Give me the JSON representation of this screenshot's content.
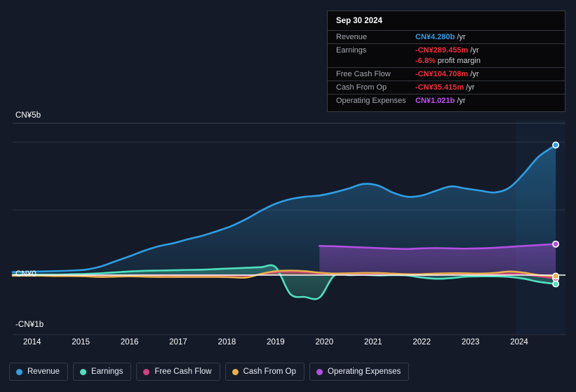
{
  "tooltip": {
    "date": "Sep 30 2024",
    "rows": [
      {
        "label": "Revenue",
        "value": "CN¥4.280b",
        "unit": "/yr",
        "color": "c-blue"
      },
      {
        "label": "Earnings",
        "value": "-CN¥289.455m",
        "unit": "/yr",
        "color": "c-red"
      },
      {
        "label": "",
        "value": "-6.8%",
        "unit": "profit margin",
        "color": "c-red",
        "sub": true
      },
      {
        "label": "Free Cash Flow",
        "value": "-CN¥104.708m",
        "unit": "/yr",
        "color": "c-red"
      },
      {
        "label": "Cash From Op",
        "value": "-CN¥35.415m",
        "unit": "/yr",
        "color": "c-red"
      },
      {
        "label": "Operating Expenses",
        "value": "CN¥1.021b",
        "unit": "/yr",
        "color": "c-purple"
      }
    ]
  },
  "axis": {
    "y_top": "CN¥5b",
    "y_zero": "CN¥0",
    "y_bottom": "-CN¥1b"
  },
  "legend": {
    "items": [
      {
        "label": "Revenue",
        "color": "#2f9fe3"
      },
      {
        "label": "Earnings",
        "color": "#4fe0c0"
      },
      {
        "label": "Free Cash Flow",
        "color": "#d2427f"
      },
      {
        "label": "Cash From Op",
        "color": "#e8b04b"
      },
      {
        "label": "Operating Expenses",
        "color": "#b24fe0"
      }
    ]
  },
  "chart_data": {
    "type": "area",
    "title": "",
    "xlabel": "",
    "ylabel": "CN¥",
    "xlim": [
      2013.6,
      2024.95
    ],
    "ylim": [
      -1.35,
      5.6
    ],
    "grid": true,
    "legend_position": "bottom",
    "currency": "CN¥",
    "units": "billions",
    "tick_labels_x": [
      "2014",
      "2015",
      "2016",
      "2017",
      "2018",
      "2019",
      "2020",
      "2021",
      "2022",
      "2023",
      "2024"
    ],
    "tick_labels_y": [
      "CN¥5b",
      "CN¥0",
      "-CN¥1b"
    ],
    "highlight_band": {
      "from": 2024.25,
      "to": 2024.95
    },
    "x": [
      2013.6,
      2013.9,
      2014.2,
      2014.5,
      2014.8,
      2015.1,
      2015.4,
      2015.7,
      2016.0,
      2016.3,
      2016.6,
      2016.9,
      2017.2,
      2017.5,
      2017.8,
      2018.1,
      2018.4,
      2018.7,
      2019.0,
      2019.3,
      2019.6,
      2019.9,
      2020.2,
      2020.5,
      2020.8,
      2021.1,
      2021.4,
      2021.7,
      2022.0,
      2022.3,
      2022.6,
      2022.9,
      2023.2,
      2023.5,
      2023.8,
      2024.1,
      2024.4,
      2024.75
    ],
    "series": [
      {
        "name": "Revenue",
        "color": "#2f9fe3",
        "values": [
          0.1,
          0.11,
          0.12,
          0.13,
          0.15,
          0.18,
          0.28,
          0.45,
          0.62,
          0.8,
          0.95,
          1.05,
          1.18,
          1.3,
          1.45,
          1.62,
          1.85,
          2.12,
          2.35,
          2.5,
          2.58,
          2.62,
          2.72,
          2.85,
          3.0,
          2.95,
          2.72,
          2.58,
          2.62,
          2.78,
          2.92,
          2.85,
          2.78,
          2.72,
          2.88,
          3.35,
          3.9,
          4.28
        ]
      },
      {
        "name": "Earnings",
        "color": "#4fe0c0",
        "values": [
          0.02,
          0.02,
          0.02,
          0.02,
          0.03,
          0.04,
          0.06,
          0.09,
          0.12,
          0.14,
          0.15,
          0.16,
          0.17,
          0.18,
          0.2,
          0.22,
          0.24,
          0.26,
          0.26,
          -0.62,
          -0.72,
          -0.74,
          -0.02,
          0.0,
          0.01,
          -0.01,
          0.0,
          -0.01,
          -0.08,
          -0.12,
          -0.1,
          -0.05,
          -0.04,
          -0.04,
          -0.06,
          -0.12,
          -0.22,
          -0.289
        ]
      },
      {
        "name": "Free Cash Flow",
        "color": "#d2427f",
        "values": [
          -0.01,
          -0.01,
          -0.01,
          -0.01,
          -0.01,
          -0.01,
          -0.01,
          -0.01,
          -0.01,
          -0.01,
          -0.01,
          -0.01,
          -0.01,
          -0.01,
          -0.01,
          -0.01,
          -0.01,
          0.02,
          0.1,
          0.12,
          0.1,
          0.06,
          0.02,
          0.02,
          0.03,
          0.03,
          0.02,
          0.01,
          0.0,
          0.01,
          0.02,
          0.02,
          0.01,
          0.02,
          0.04,
          0.02,
          -0.04,
          -0.105
        ]
      },
      {
        "name": "Cash From Op",
        "color": "#e8b04b",
        "values": [
          -0.02,
          -0.02,
          -0.02,
          -0.03,
          -0.03,
          -0.04,
          -0.06,
          -0.05,
          -0.04,
          -0.05,
          -0.06,
          -0.06,
          -0.06,
          -0.06,
          -0.06,
          -0.07,
          -0.08,
          0.04,
          0.13,
          0.15,
          0.13,
          0.08,
          0.05,
          0.06,
          0.07,
          0.07,
          0.05,
          0.03,
          0.03,
          0.05,
          0.06,
          0.06,
          0.05,
          0.07,
          0.12,
          0.08,
          0.0,
          -0.035
        ]
      },
      {
        "name": "Operating Expenses",
        "color": "#b24fe0",
        "start_x": 2019.75,
        "values": [
          null,
          null,
          null,
          null,
          null,
          null,
          null,
          null,
          null,
          null,
          null,
          null,
          null,
          null,
          null,
          null,
          null,
          null,
          null,
          null,
          null,
          0.96,
          0.95,
          0.93,
          0.91,
          0.89,
          0.87,
          0.86,
          0.88,
          0.89,
          0.88,
          0.87,
          0.88,
          0.9,
          0.93,
          0.96,
          0.99,
          1.021
        ]
      }
    ]
  }
}
